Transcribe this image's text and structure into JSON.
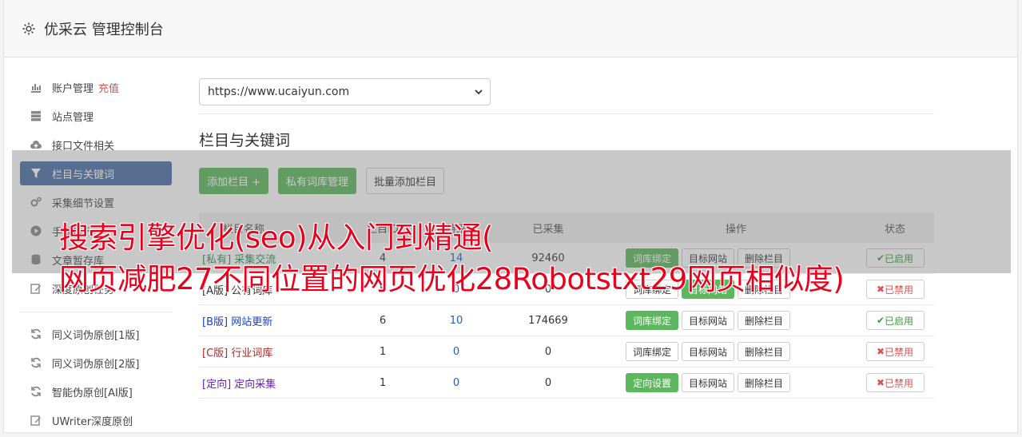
{
  "header": {
    "title": "优采云 管理控制台",
    "icon": "gear-icon"
  },
  "sidebar": {
    "items": [
      {
        "label": "账户管理",
        "extra": "充值",
        "icon": "bar-chart-icon"
      },
      {
        "label": "站点管理",
        "icon": "server-icon"
      },
      {
        "label": "接口文件相关",
        "icon": "cloud-upload-icon"
      },
      {
        "label": "栏目与关键词",
        "icon": "filter-icon",
        "active": true
      },
      {
        "label": "采集细节设置",
        "icon": "cogs-icon"
      },
      {
        "label": "手动执行",
        "icon": "play-icon"
      },
      {
        "label": "文章暂存库",
        "icon": "database-icon"
      },
      {
        "label": "深度原创任务",
        "icon": "edit-icon"
      }
    ],
    "tools": [
      {
        "label": "同义词伪原创[1版]",
        "icon": "refresh-icon"
      },
      {
        "label": "同义词伪原创[2版]",
        "icon": "refresh-icon"
      },
      {
        "label": "智能伪原创[AI版]",
        "icon": "refresh-icon"
      },
      {
        "label": "UWriter深度原创",
        "icon": "edit-icon"
      }
    ]
  },
  "site_select": {
    "value": "https://www.ucaiyun.com"
  },
  "section": {
    "title": "栏目与关键词"
  },
  "buttons": {
    "add_column": "添加栏目 +",
    "private_lexicon": "私有词库管理",
    "batch_add": "批量添加栏目"
  },
  "table": {
    "headers": [
      "栏目名称",
      "栏目ID",
      "待采",
      "已采集",
      "操作",
      "状态"
    ],
    "rows": [
      {
        "tag": "[私有]",
        "name": "采集交流",
        "id": "4",
        "pending": "14",
        "collected": "92460",
        "action1": "词库绑定",
        "action2": "目标网站",
        "action3": "删除栏目",
        "status": "已启用"
      },
      {
        "tag": "[A版]",
        "name": "公有词库",
        "id": "5",
        "pending": "0",
        "collected": "0",
        "action1": "词库绑定",
        "action2": "目标网站",
        "action3": "删除栏目",
        "status": "已禁用"
      },
      {
        "tag": "[B版]",
        "name": "网站更新",
        "id": "6",
        "pending": "10",
        "collected": "174669",
        "action1": "词库绑定",
        "action2": "目标网站",
        "action3": "删除栏目",
        "status": "已启用"
      },
      {
        "tag": "[C版]",
        "name": "行业词库",
        "id": "1",
        "pending": "0",
        "collected": "0",
        "action1": "词库绑定",
        "action2": "目标网站",
        "action3": "删除栏目",
        "status": "已禁用"
      },
      {
        "tag": "[定向]",
        "name": "定向采集",
        "id": "1",
        "pending": "0",
        "collected": "0",
        "action1": "定向设置",
        "action2": "目标网站",
        "action3": "删除栏目",
        "status": "已禁用"
      }
    ]
  },
  "overlay": {
    "line1": "搜索引擎优化(seo)从入门到精通(",
    "line2": "网页减肥27不同位置的网页优化28Robotstxt29网页相似度)"
  },
  "colors": {
    "active_nav": "#4a6fa5",
    "green": "#5cb85c",
    "red": "#d9534f",
    "overlay_text": "#e8001c"
  }
}
